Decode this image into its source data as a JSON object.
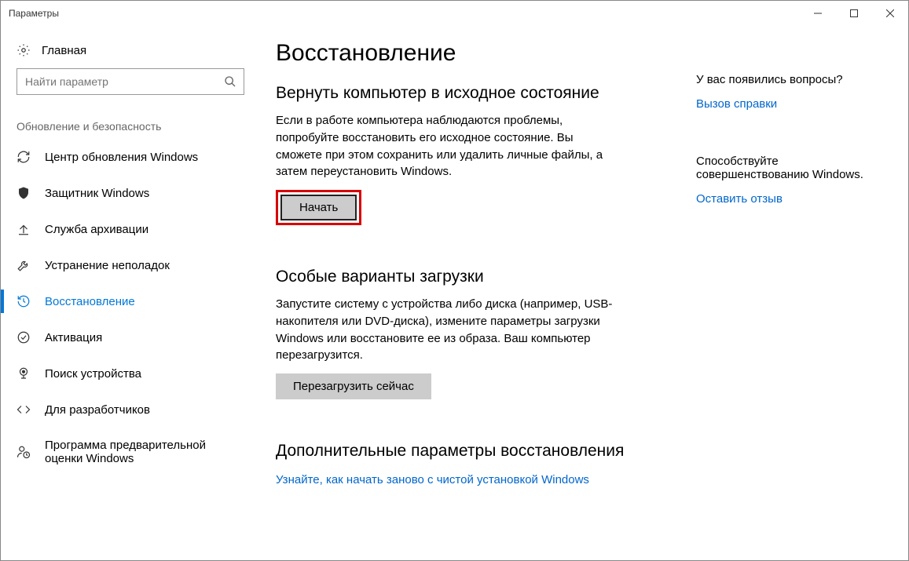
{
  "window": {
    "title": "Параметры"
  },
  "sidebar": {
    "home": "Главная",
    "search_placeholder": "Найти параметр",
    "group": "Обновление и безопасность",
    "items": [
      {
        "label": "Центр обновления Windows"
      },
      {
        "label": "Защитник Windows"
      },
      {
        "label": "Служба архивации"
      },
      {
        "label": "Устранение неполадок"
      },
      {
        "label": "Восстановление"
      },
      {
        "label": "Активация"
      },
      {
        "label": "Поиск устройства"
      },
      {
        "label": "Для разработчиков"
      },
      {
        "label": "Программа предварительной оценки Windows"
      }
    ]
  },
  "main": {
    "title": "Восстановление",
    "section1": {
      "title": "Вернуть компьютер в исходное состояние",
      "desc": "Если в работе компьютера наблюдаются проблемы, попробуйте восстановить его исходное состояние. Вы сможете при этом сохранить или удалить личные файлы, а затем переустановить Windows.",
      "button": "Начать"
    },
    "section2": {
      "title": "Особые варианты загрузки",
      "desc": "Запустите систему с устройства либо диска (например, USB-накопителя или DVD-диска), измените параметры загрузки Windows или восстановите ее из образа. Ваш компьютер перезагрузится.",
      "button": "Перезагрузить сейчас"
    },
    "section3": {
      "title": "Дополнительные параметры восстановления",
      "link": "Узнайте, как начать заново с чистой установкой Windows"
    }
  },
  "right": {
    "q_title": "У вас появились вопросы?",
    "q_link": "Вызов справки",
    "f_title": "Способствуйте совершенствованию Windows.",
    "f_link": "Оставить отзыв"
  }
}
